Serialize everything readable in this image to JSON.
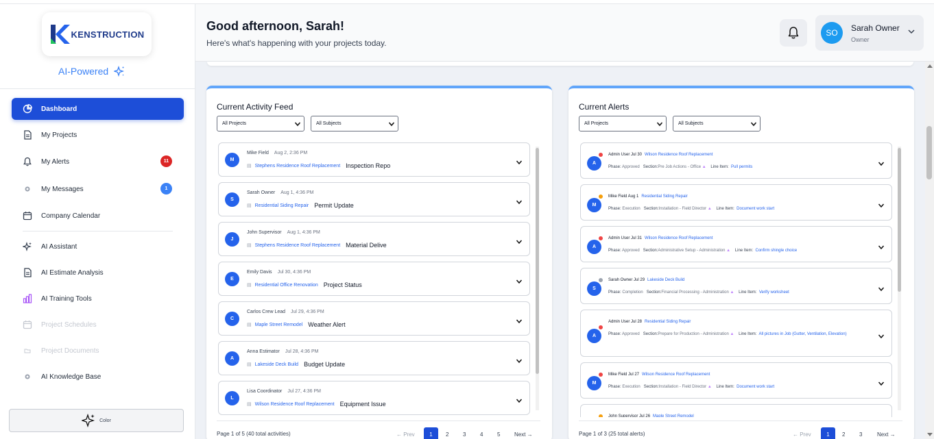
{
  "brand": {
    "name": "KENSTRUCTION",
    "tagline": "AI-Powered"
  },
  "sidebar": {
    "items": [
      {
        "label": "Dashboard",
        "icon": "pie-chart-icon",
        "state": "active"
      },
      {
        "label": "My Projects",
        "icon": "document-icon",
        "state": "normal"
      },
      {
        "label": "My Alerts",
        "icon": "bell-icon",
        "state": "normal",
        "badge": "11",
        "badge_color": "#dc2626"
      },
      {
        "label": "My Messages",
        "icon": "message-icon",
        "state": "normal",
        "badge": "1",
        "badge_color": "#3b82f6"
      },
      {
        "label": "Company Calendar",
        "icon": "calendar-icon",
        "state": "normal"
      },
      {
        "label": "AI Assistant",
        "icon": "sparkle-icon",
        "state": "normal"
      },
      {
        "label": "AI Estimate Analysis",
        "icon": "document-icon",
        "state": "normal"
      },
      {
        "label": "AI Training Tools",
        "icon": "bar-chart-icon",
        "state": "normal"
      },
      {
        "label": "Project Schedules",
        "icon": "calendar-icon",
        "state": "disabled"
      },
      {
        "label": "Project Documents",
        "icon": "folder-icon",
        "state": "disabled"
      },
      {
        "label": "AI Knowledge Base",
        "icon": "message-icon",
        "state": "normal"
      }
    ],
    "color_button": "Color"
  },
  "header": {
    "greeting": "Good afternoon, Sarah!",
    "subtitle": "Here's what's happening with your projects today.",
    "user": {
      "initials": "SO",
      "name": "Sarah Owner",
      "role": "Owner"
    }
  },
  "activity": {
    "title": "Current Activity Feed",
    "filter_project": "All Projects",
    "filter_subject": "All Subjects",
    "items": [
      {
        "initial": "M",
        "author": "Mike Field",
        "time": "Aug 2, 2:36 PM",
        "project": "Stephens Residence Roof Replacement",
        "subject": "Inspection Repo"
      },
      {
        "initial": "S",
        "author": "Sarah Owner",
        "time": "Aug 1, 4:36 PM",
        "project": "Residential Siding Repair",
        "subject": "Permit Update"
      },
      {
        "initial": "J",
        "author": "John Supervisor",
        "time": "Aug 1, 4:36 PM",
        "project": "Stephens Residence Roof Replacement",
        "subject": "Material Delive"
      },
      {
        "initial": "E",
        "author": "Emily Davis",
        "time": "Jul 30, 4:36 PM",
        "project": "Residential Office Renovation",
        "subject": "Project Status"
      },
      {
        "initial": "C",
        "author": "Carlos Crew Lead",
        "time": "Jul 29, 4:36 PM",
        "project": "Maple Street Remodel",
        "subject": "Weather Alert"
      },
      {
        "initial": "A",
        "author": "Anna Estimator",
        "time": "Jul 28, 4:36 PM",
        "project": "Lakeside Deck Build",
        "subject": "Budget Update"
      },
      {
        "initial": "L",
        "author": "Lisa Coordinator",
        "time": "Jul 27, 4:36 PM",
        "project": "Wilson Residence Roof Replacement",
        "subject": "Equipment Issue"
      }
    ],
    "page_info": "Page 1 of 5 (40 total activities)",
    "pager": {
      "prev": "← Prev",
      "next": "Next →",
      "pages": [
        "1",
        "2",
        "3",
        "4",
        "5"
      ]
    }
  },
  "alerts": {
    "title": "Current Alerts",
    "filter_project": "All Projects",
    "filter_subject": "All Subjects",
    "items": [
      {
        "initial": "A",
        "dot": "#ef4444",
        "head": "Admin User Jul 30",
        "project": "Wilson Residence Roof Replacement",
        "phase": "Approved",
        "section": "Pre Job Actions",
        "dept": "Office",
        "line_item": "Pull permits"
      },
      {
        "initial": "M",
        "dot": "#f59e0b",
        "head": "Mike Field Aug 1",
        "project": "Residential Siding Repair",
        "phase": "Execution",
        "section": "Installation",
        "dept": "Field Director",
        "line_item": "Document work start"
      },
      {
        "initial": "A",
        "dot": "#ef4444",
        "head": "Admin User Jul 31",
        "project": "Wilson Residence Roof Replacement",
        "phase": "Approved",
        "section": "Administrative Setup",
        "dept": "Administration",
        "line_item": "Confirm shingle choice"
      },
      {
        "initial": "S",
        "dot": "#9ca3af",
        "head": "Sarah Owner Jul 29",
        "project": "Lakeside Deck Build",
        "phase": "Completion",
        "section": "Financial Processing",
        "dept": "Administration",
        "line_item": "Verify worksheet"
      },
      {
        "initial": "A",
        "dot": "#ef4444",
        "head": "Admin User Jul 28",
        "project": "Residential Siding Repair",
        "phase": "Approved",
        "section": "Prepare for Production",
        "dept": "Administration",
        "line_item": "All pictures in Job (Gutter, Ventilation, Elevation)"
      },
      {
        "initial": "M",
        "dot": "#ef4444",
        "head": "Mike Field Jul 27",
        "project": "Wilson Residence Roof Replacement",
        "phase": "Execution",
        "section": "Installation",
        "dept": "Field Director",
        "line_item": "Document work start"
      },
      {
        "initial": "J",
        "dot": "#f59e0b",
        "head": "John Supervisor Jul 26",
        "project": "Maple Street Remodel",
        "phase": "",
        "section": "",
        "dept": "",
        "line_item": ""
      }
    ],
    "labels": {
      "phase": "Phase:",
      "section": "Section:",
      "line_item": "Line Item:",
      "sep": " - "
    },
    "page_info": "Page 1 of 3 (25 total alerts)",
    "pager": {
      "prev": "← Prev",
      "next": "Next →",
      "pages": [
        "1",
        "2",
        "3"
      ]
    }
  },
  "colors": {
    "accent": "#1d4ed8",
    "panel_top": "#60a5fa",
    "link": "#2563eb"
  }
}
